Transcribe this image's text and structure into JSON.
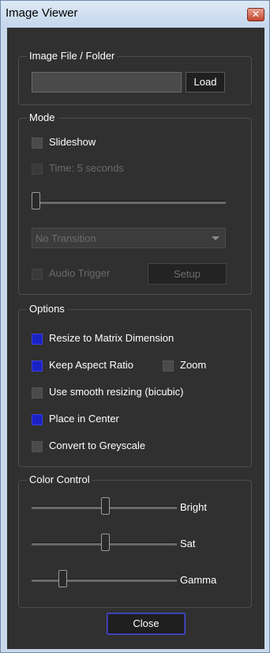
{
  "window": {
    "title": "Image Viewer",
    "close_glyph": "✕"
  },
  "image_file": {
    "legend": "Image File / Folder",
    "path_value": "",
    "load_label": "Load"
  },
  "mode": {
    "legend": "Mode",
    "slideshow_label": "Slideshow",
    "slideshow_checked": false,
    "time_label": "Time: 5 seconds",
    "time_checked": false,
    "time_slider_level": 0.0,
    "transition_selected": "No Transition",
    "audio_trigger_label": "Audio Trigger",
    "audio_trigger_checked": false,
    "setup_label": "Setup"
  },
  "options": {
    "legend": "Options",
    "resize_label": "Resize to Matrix Dimension",
    "resize_checked": true,
    "aspect_label": "Keep Aspect Ratio",
    "aspect_checked": true,
    "zoom_label": "Zoom",
    "zoom_checked": false,
    "smooth_label": "Use smooth resizing (bicubic)",
    "smooth_checked": false,
    "center_label": "Place in Center",
    "center_checked": true,
    "grey_label": "Convert to Greyscale",
    "grey_checked": false
  },
  "color_control": {
    "legend": "Color Control",
    "bright_label": "Bright",
    "bright_level": 0.5,
    "sat_label": "Sat",
    "sat_level": 0.5,
    "gamma_label": "Gamma",
    "gamma_level": 0.2
  },
  "footer": {
    "close_label": "Close"
  },
  "colors": {
    "panel_bg": "#303030",
    "checked_blue": "#1b22c4",
    "text": "#ffffff",
    "disabled_text": "#6a6a6a"
  }
}
